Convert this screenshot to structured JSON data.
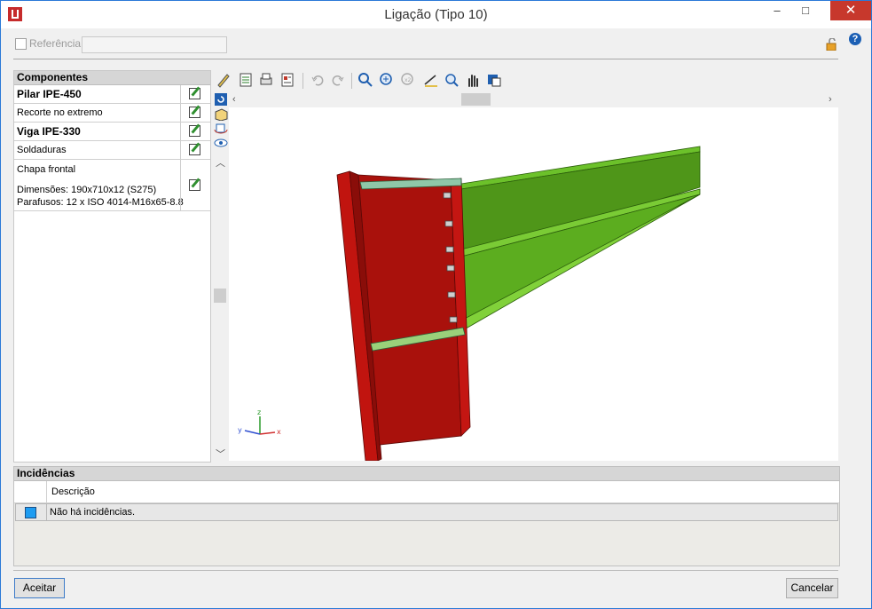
{
  "window": {
    "title": "Ligação (Tipo 10)",
    "minimize": "–",
    "maximize": "□",
    "close": "✕"
  },
  "reference": {
    "label": "Referência",
    "value": ""
  },
  "components": {
    "header": "Componentes",
    "rows": [
      {
        "label": "Pilar IPE-450"
      },
      {
        "label": "Recorte no extremo"
      },
      {
        "label": "Viga IPE-330"
      },
      {
        "label": "Soldaduras"
      },
      {
        "label": "Chapa frontal"
      },
      {
        "line1": "Dimensões: 190x710x12 (S275)",
        "line2": "Parafusos: 12 x ISO 4014-M16x65-8.8"
      }
    ]
  },
  "toolbar": {
    "icons": [
      "pencil-icon",
      "list-icon",
      "printer-icon",
      "report-icon",
      "undo-icon",
      "redo-icon",
      "rotate-icon",
      "zoom-all-icon",
      "zoom-2x-icon",
      "measure-icon",
      "zoom-window-icon",
      "pan-icon",
      "export-icon"
    ]
  },
  "viewer": {
    "colors": {
      "column": "#b5140f",
      "column_dark": "#8a0d09",
      "beam": "#55a81c",
      "beam_dark": "#3f7f12",
      "plate": "#7fb7a2"
    },
    "axes": {
      "x": "x",
      "y": "y",
      "z": "z"
    }
  },
  "incidences": {
    "header": "Incidências",
    "column": "Descrição",
    "rows": [
      {
        "text": "Não há incidências."
      }
    ]
  },
  "buttons": {
    "ok": "Aceitar",
    "cancel": "Cancelar"
  }
}
